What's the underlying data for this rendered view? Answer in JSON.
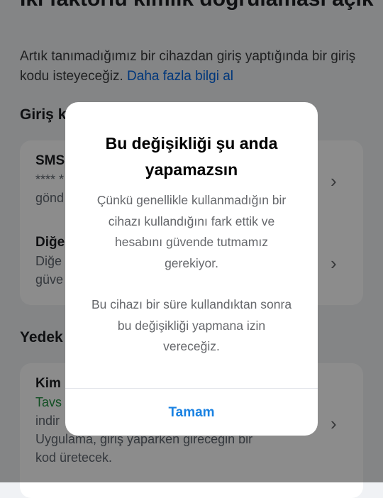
{
  "background": {
    "heading": "İki faktörlü kimlik doğrulaması açık",
    "subtitle_text": "Artık tanımadığımız bir cihazdan giriş yaptığında bir giriş kodu isteyeceğiz.",
    "subtitle_link": "Daha fazla bilgi al",
    "section_methods": "Giriş k",
    "sms_title": "SMS",
    "sms_mask": "**** *",
    "sms_sub": "gönd",
    "other_title": "Diğe",
    "other_line1": "Diğe",
    "other_line2": "güve",
    "section_backup": "Yedek",
    "auth_title": "Kim",
    "auth_recommended": "Tavs",
    "auth_line1": "indir",
    "auth_line2": "Uygulama, giriş yaparken gireceğin bir",
    "auth_line3": "kod üretecek."
  },
  "dialog": {
    "title": "Bu değişikliği şu anda yapamazsın",
    "body_paragraph_1": "Çünkü genellikle kullanmadığın bir cihazı kullandığını fark ettik ve hesabını güvende tutmamız gerekiyor.",
    "body_paragraph_2": "Bu cihazı bir süre kullandıktan sonra bu değişikliği yapmana izin vereceğiz.",
    "ok_button": "Tamam"
  },
  "colors": {
    "link": "#0064e0",
    "button": "#1a82e2",
    "recommended": "#1e8e3e"
  }
}
